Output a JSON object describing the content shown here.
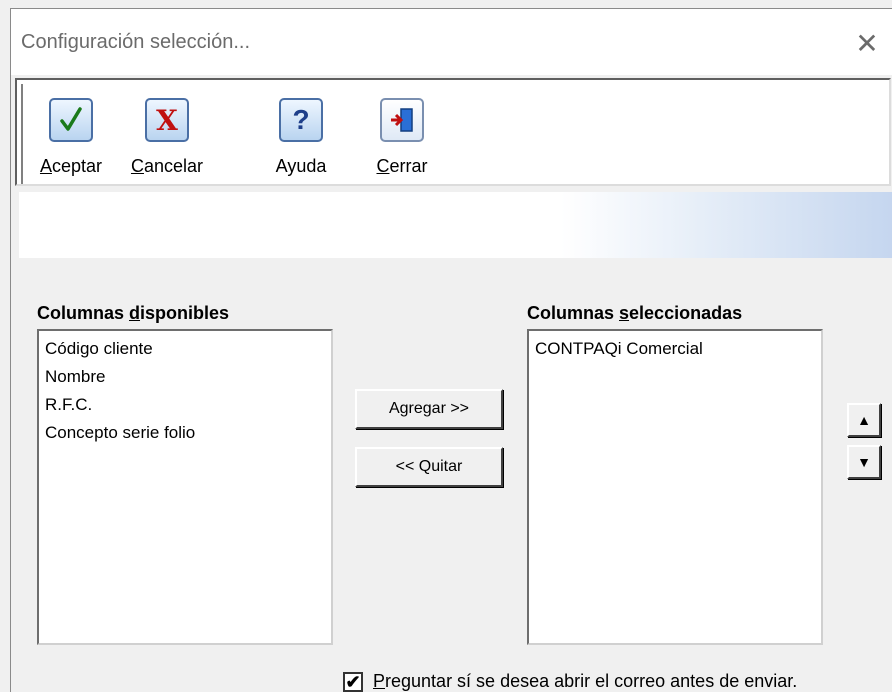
{
  "window": {
    "title": "Configuración selección...",
    "close_glyph": "✕"
  },
  "toolbar": {
    "buttons": [
      {
        "accel": "A",
        "rest": "ceptar",
        "icon": "check-icon",
        "glyph": "√",
        "color": "#1a7a1a"
      },
      {
        "accel": "C",
        "rest": "ancelar",
        "icon": "cancel-x-icon",
        "glyph": "X",
        "color": "#c01010"
      },
      {
        "accel": "",
        "rest": "Ayuda",
        "icon": "help-icon",
        "glyph": "?",
        "color": "#1e3f8a"
      },
      {
        "accel": "C",
        "rest": "errar",
        "icon": "exit-door-icon",
        "glyph": "",
        "color": "#1e5fbf"
      }
    ]
  },
  "available": {
    "label_pre": "Columnas ",
    "label_accel": "d",
    "label_post": "isponibles",
    "items": [
      "Código cliente",
      "Nombre",
      "R.F.C.",
      "Concepto serie folio"
    ]
  },
  "selected": {
    "label_pre": "Columnas ",
    "label_accel": "s",
    "label_post": "eleccionadas",
    "items": [
      "CONTPAQi Comercial"
    ]
  },
  "actions": {
    "add_label": "Agregar >>",
    "remove_label": "<< Quitar"
  },
  "order": {
    "up_glyph": "▲",
    "down_glyph": "▼"
  },
  "option": {
    "checked": true,
    "check_glyph": "✔",
    "label_accel": "P",
    "label_rest": "reguntar sí se desea abrir el correo antes de enviar."
  }
}
